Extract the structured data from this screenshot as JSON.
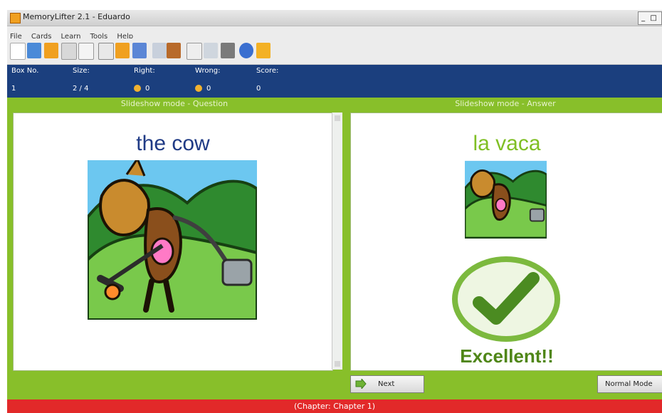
{
  "window": {
    "title": "MemoryLifter 2.1 - Eduardo",
    "controls": "_ □"
  },
  "menu": [
    "File",
    "Cards",
    "Learn",
    "Tools",
    "Help"
  ],
  "toolbar_icons": [
    "new-icon",
    "open-icon",
    "save-icon",
    "print-icon",
    "print-preview-icon",
    "edit-icon",
    "cards-icon",
    "chapter-icon",
    "statistics-icon",
    "options-icon",
    "card-editor-icon",
    "tools-icon",
    "media-icon",
    "help-icon",
    "exit-icon"
  ],
  "stats": {
    "labels": {
      "box": "Box No.",
      "size": "Size:",
      "right": "Right:",
      "wrong": "Wrong:",
      "score": "Score:"
    },
    "values": {
      "box": "1",
      "size": "2 / 4",
      "right": "0",
      "wrong": "0",
      "score": "0"
    }
  },
  "question": {
    "header": "Slideshow mode - Question",
    "word": "the cow"
  },
  "answer": {
    "header": "Slideshow mode - Answer",
    "word": "la vaca",
    "feedback": "Excellent!!"
  },
  "buttons": {
    "next": "Next",
    "normal_mode": "Normal Mode"
  },
  "footer": "(Chapter: Chapter 1)",
  "colors": {
    "blue_bar": "#1b3f7e",
    "green": "#88bf2a",
    "red_bar": "#e22929",
    "question_text": "#1f3a85",
    "answer_text": "#7fbf24"
  }
}
